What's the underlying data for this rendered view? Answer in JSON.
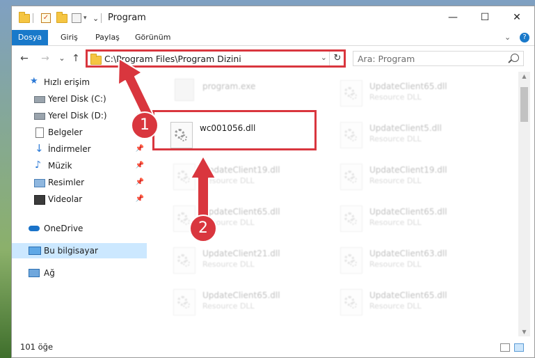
{
  "window": {
    "title": "Program",
    "minimize": "—",
    "maximize": "☐",
    "close": "✕"
  },
  "ribbon": {
    "tabs": [
      "Dosya",
      "Giriş",
      "Paylaş",
      "Görünüm"
    ],
    "expand": "⌄",
    "help": "?"
  },
  "nav": {
    "back": "←",
    "forward": "→",
    "recent": "⌄",
    "up": "↑",
    "address": "C:\\Program Files\\Program Dizini",
    "address_dropdown": "⌄",
    "refresh": "↻",
    "search_placeholder": "Ara: Program"
  },
  "sidebar": {
    "items": [
      {
        "label": "Hızlı erişim",
        "icon": "star-icon"
      },
      {
        "label": "Yerel Disk (C:)",
        "icon": "drive-icon",
        "pin": "📌"
      },
      {
        "label": "Yerel Disk (D:)",
        "icon": "drive-icon",
        "pin": "📌"
      },
      {
        "label": "Belgeler",
        "icon": "document-icon",
        "pin": "📌"
      },
      {
        "label": "İndirmeler",
        "icon": "download-icon",
        "pin": "📌"
      },
      {
        "label": "Müzik",
        "icon": "music-icon",
        "pin": "📌"
      },
      {
        "label": "Resimler",
        "icon": "pictures-icon",
        "pin": "📌"
      },
      {
        "label": "Videolar",
        "icon": "video-icon",
        "pin": "📌"
      },
      {
        "label": "OneDrive",
        "icon": "cloud-icon"
      },
      {
        "label": "Bu bilgisayar",
        "icon": "computer-icon"
      },
      {
        "label": "Ağ",
        "icon": "network-icon"
      }
    ]
  },
  "files": [
    {
      "name": "program.exe",
      "type": ""
    },
    {
      "name": "UpdateClient65.dll",
      "type": "Resource DLL"
    },
    {
      "name": "wc001056.dll",
      "type": ""
    },
    {
      "name": "UpdateClient5.dll",
      "type": "Resource DLL"
    },
    {
      "name": "UpdateClient19.dll",
      "type": "Resource DLL"
    },
    {
      "name": "UpdateClient19.dll",
      "type": "Resource DLL"
    },
    {
      "name": "UpdateClient65.dll",
      "type": "Resource DLL"
    },
    {
      "name": "UpdateClient65.dll",
      "type": "Resource DLL"
    },
    {
      "name": "UpdateClient21.dll",
      "type": "Resource DLL"
    },
    {
      "name": "UpdateClient63.dll",
      "type": "Resource DLL"
    },
    {
      "name": "UpdateClient65.dll",
      "type": "Resource DLL"
    },
    {
      "name": "UpdateClient65.dll",
      "type": "Resource DLL"
    }
  ],
  "status": {
    "count": "101 öğe"
  },
  "callouts": [
    "1",
    "2"
  ],
  "colors": {
    "accent": "#1979ca",
    "highlight": "#d9363e",
    "selection": "#cce8ff"
  }
}
